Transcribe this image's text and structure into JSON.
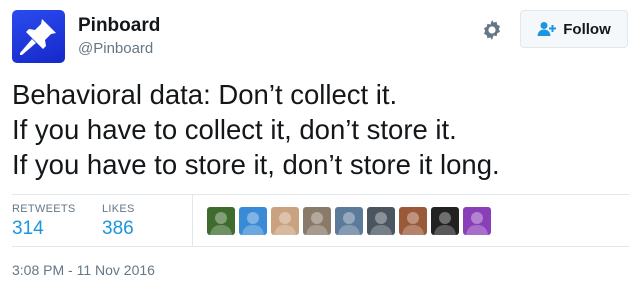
{
  "user": {
    "name": "Pinboard",
    "handle": "@Pinboard"
  },
  "actions": {
    "follow_label": "Follow"
  },
  "tweet": {
    "lines": [
      "Behavioral data: Don’t collect it.",
      "If you have to collect it, don’t store it.",
      "If you have to store it, don’t store it long."
    ]
  },
  "stats": {
    "retweets_label": "RETWEETS",
    "retweets_count": "314",
    "likes_label": "LIKES",
    "likes_count": "386"
  },
  "likers": [
    {
      "icon": "avatar-forest",
      "color": "#3f6b2e"
    },
    {
      "icon": "avatar-brain-badge",
      "color": "#3a8bd6"
    },
    {
      "icon": "avatar-two-people",
      "color": "#c9a27f"
    },
    {
      "icon": "avatar-bearded-man",
      "color": "#8a7a6a"
    },
    {
      "icon": "avatar-man-city",
      "color": "#5c7a9a"
    },
    {
      "icon": "avatar-man-glasses",
      "color": "#4a5560"
    },
    {
      "icon": "avatar-woman-curly",
      "color": "#9a5a3a"
    },
    {
      "icon": "avatar-brain-scan",
      "color": "#222222"
    },
    {
      "icon": "avatar-purple-figure",
      "color": "#8a3fb8"
    }
  ],
  "timestamp": "3:08 PM - 11 Nov 2016",
  "colors": {
    "accent": "#1b95e0",
    "muted": "#657786",
    "border": "#e1e8ed",
    "brand_avatar": "#1e3ade"
  }
}
